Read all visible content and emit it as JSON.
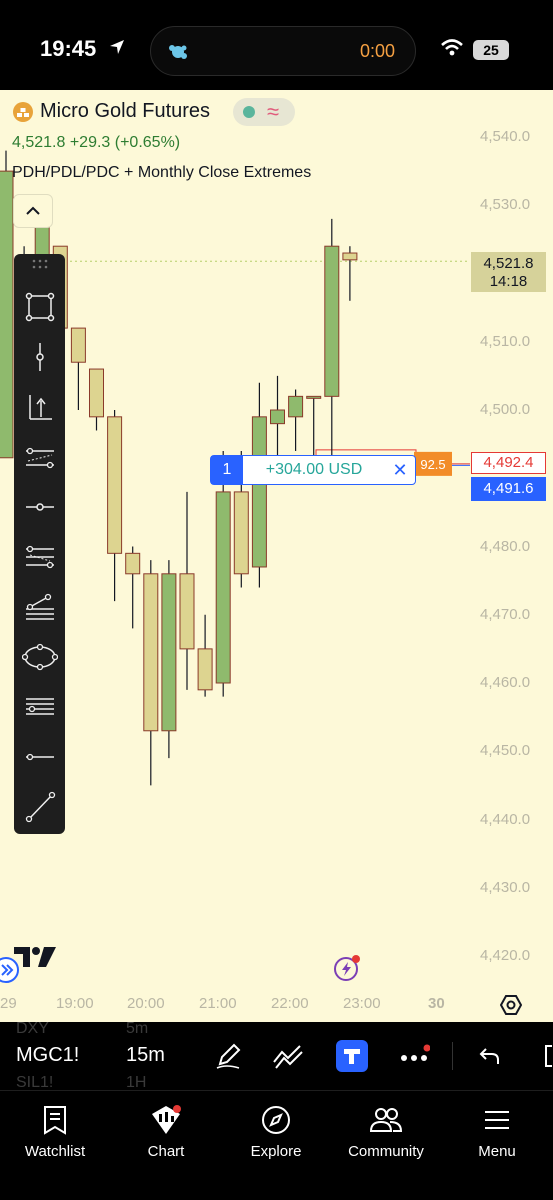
{
  "status_bar": {
    "time": "19:45",
    "island_timer": "0:00",
    "battery": "25"
  },
  "chart_header": {
    "symbol_name": "Micro Gold Futures",
    "price_change": "4,521.8  +29.3 (+0.65%)",
    "indicator": "PDH/PDL/PDC + Monthly Close Extremes"
  },
  "position": {
    "qty": "1",
    "pnl": "+304.00 USD",
    "close_glyph": "✕",
    "hidden_label": "92.5"
  },
  "price_tags": {
    "current_price": "4,521.8",
    "countdown": "14:18",
    "order_price": "4,492.4",
    "position_price": "4,491.6"
  },
  "y_axis": [
    "4,540.0",
    "4,530.0",
    "4,510.0",
    "4,500.0",
    "4,480.0",
    "4,470.0",
    "4,460.0",
    "4,450.0",
    "4,440.0",
    "4,430.0",
    "4,420.0"
  ],
  "x_axis": [
    "29",
    "19:00",
    "20:00",
    "21:00",
    "22:00",
    "23:00",
    "30"
  ],
  "chart_data": {
    "type": "candlestick",
    "interval": "15m",
    "ylim": [
      4417,
      4545
    ],
    "candles": [
      {
        "o": 4493,
        "h": 4538,
        "l": 4494,
        "c": 4535
      },
      {
        "o": 4515,
        "h": 4524,
        "l": 4497,
        "c": 4520
      },
      {
        "o": 4520,
        "h": 4527,
        "l": 4497,
        "c": 4527
      },
      {
        "o": 4524,
        "h": 4524,
        "l": 4507,
        "c": 4512
      },
      {
        "o": 4512,
        "h": 4512,
        "l": 4500,
        "c": 4507
      },
      {
        "o": 4506,
        "h": 4506,
        "l": 4497,
        "c": 4499
      },
      {
        "o": 4499,
        "h": 4500,
        "l": 4472,
        "c": 4479
      },
      {
        "o": 4479,
        "h": 4480,
        "l": 4468,
        "c": 4476
      },
      {
        "o": 4476,
        "h": 4478,
        "l": 4445,
        "c": 4453
      },
      {
        "o": 4453,
        "h": 4478,
        "l": 4449,
        "c": 4476
      },
      {
        "o": 4476,
        "h": 4488,
        "l": 4459,
        "c": 4465
      },
      {
        "o": 4465,
        "h": 4470,
        "l": 4458,
        "c": 4459
      },
      {
        "o": 4460,
        "h": 4494,
        "l": 4458,
        "c": 4488
      },
      {
        "o": 4488,
        "h": 4494,
        "l": 4474,
        "c": 4476
      },
      {
        "o": 4477,
        "h": 4504,
        "l": 4474,
        "c": 4499
      },
      {
        "o": 4498,
        "h": 4505,
        "l": 4493,
        "c": 4500
      },
      {
        "o": 4499,
        "h": 4503,
        "l": 4494,
        "c": 4502
      },
      {
        "o": 4502,
        "h": 4502,
        "l": 4492,
        "c": 4502
      },
      {
        "o": 4502,
        "h": 4528,
        "l": 4490,
        "c": 4524
      },
      {
        "o": 4523,
        "h": 4524,
        "l": 4516,
        "c": 4522
      }
    ]
  },
  "toolbar": {
    "symbol": "MGC1!",
    "timeframe": "15m",
    "ghost_top_symbol": "DXY",
    "ghost_top_tf": "5m",
    "ghost_bottom_symbol": "SIL1!",
    "ghost_bottom_tf": "1H"
  },
  "nav": [
    "Watchlist",
    "Chart",
    "Explore",
    "Community",
    "Menu"
  ],
  "colors": {
    "chart_bg": "#fdf9d8",
    "up_candle": "#8fba6d",
    "down_candle": "#ddd490",
    "candle_border": "#8b3a2a",
    "accent_blue": "#2962ff",
    "order_red": "#e53935"
  }
}
